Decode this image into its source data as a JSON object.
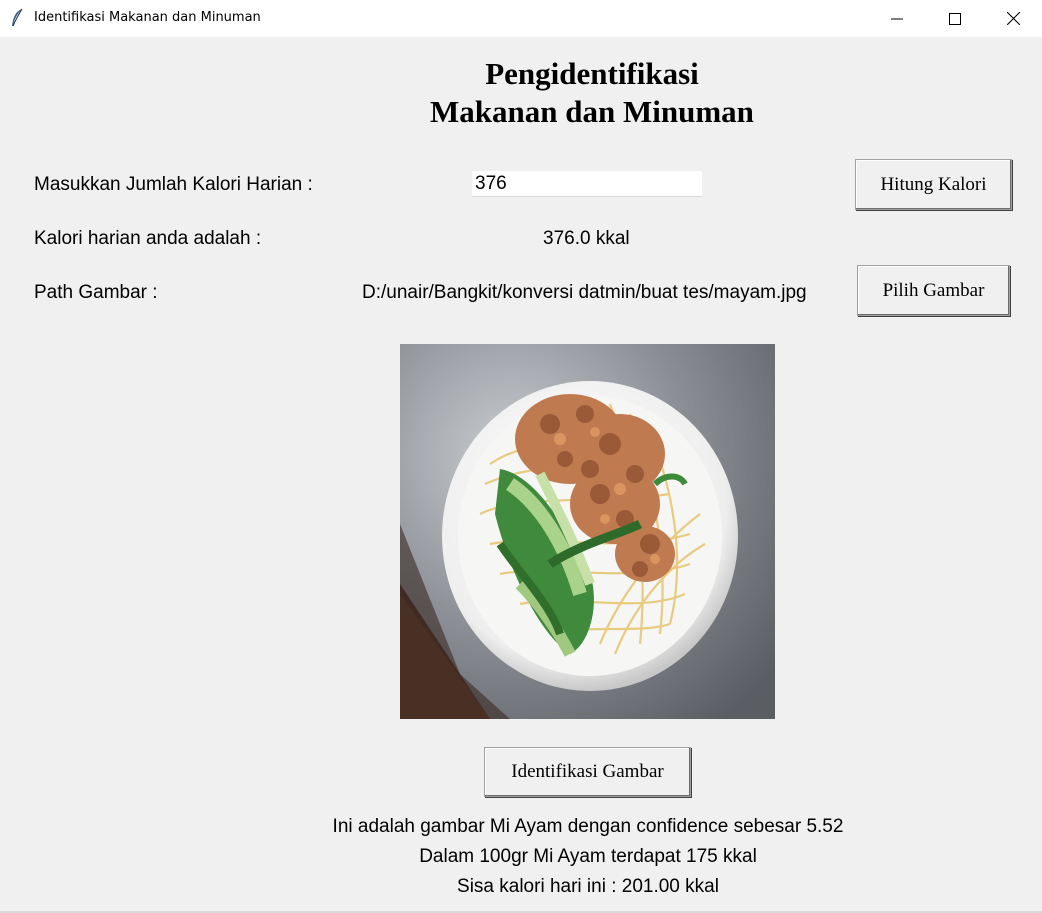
{
  "window": {
    "title": "Identifikasi Makanan dan Minuman",
    "icons": [
      "feather-icon",
      "minimize-icon",
      "maximize-icon",
      "close-icon"
    ]
  },
  "heading": {
    "line1": "Pengidentifikasi",
    "line2": "Makanan dan Minuman"
  },
  "calorie_input": {
    "label": "Masukkan Jumlah Kalori Harian :",
    "value": "376",
    "button": "Hitung Kalori"
  },
  "calorie_result": {
    "label": "Kalori harian anda adalah :",
    "value": "376.0 kkal"
  },
  "image_path": {
    "label": "Path Gambar :",
    "value": "D:/unair/Bangkit/konversi datmin/buat tes/mayam.jpg",
    "button": "Pilih Gambar"
  },
  "identify": {
    "button": "Identifikasi Gambar"
  },
  "results": {
    "line1": "Ini adalah gambar Mi Ayam dengan confidence sebesar 5.52",
    "line2": "Dalam 100gr Mi Ayam terdapat 175 kkal",
    "line3": "Sisa kalori hari ini : 201.00 kkal"
  }
}
